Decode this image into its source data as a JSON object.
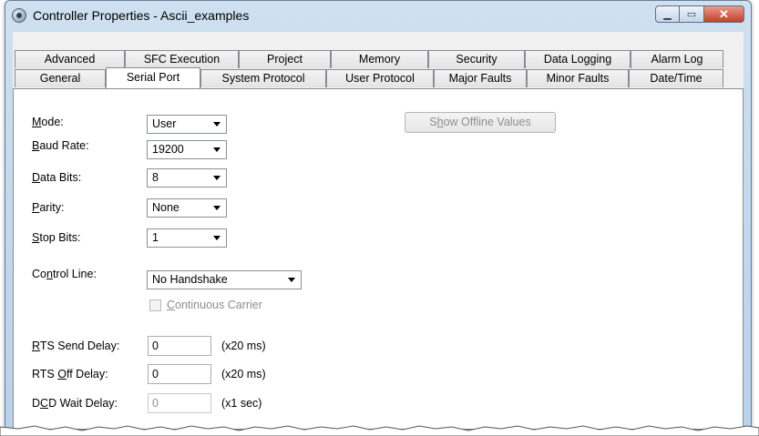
{
  "window": {
    "title": "Controller Properties - Ascii_examples",
    "minimize_glyph": "▁",
    "maximize_glyph": "▭",
    "close_glyph": "✕"
  },
  "tabs": {
    "row1": [
      "Advanced",
      "SFC Execution",
      "Project",
      "Memory",
      "Security",
      "Data Logging",
      "Alarm Log"
    ],
    "row2": [
      "General",
      "Serial Port",
      "System Protocol",
      "User Protocol",
      "Major Faults",
      "Minor Faults",
      "Date/Time"
    ],
    "active": "Serial Port"
  },
  "form": {
    "mode": {
      "label_u": "M",
      "label_rest": "ode:",
      "value": "User"
    },
    "baud_rate": {
      "label_u": "B",
      "label_rest": "aud Rate:",
      "value": "19200"
    },
    "data_bits": {
      "label_u": "D",
      "label_rest": "ata Bits:",
      "value": "8"
    },
    "parity": {
      "label_u": "P",
      "label_rest": "arity:",
      "value": "None"
    },
    "stop_bits": {
      "label_u": "S",
      "label_rest": "top Bits:",
      "value": "1"
    },
    "control_line": {
      "label_pre": "Co",
      "label_u": "n",
      "label_rest": "trol Line:",
      "value": "No Handshake"
    },
    "continuous_carrier": {
      "label_u": "C",
      "label_rest": "ontinuous Carrier",
      "checked": false,
      "enabled": false
    },
    "rts_send_delay": {
      "label_u": "R",
      "label_rest": "TS Send Delay:",
      "value": "0",
      "unit": "(x20 ms)"
    },
    "rts_off_delay": {
      "label_pre": "RTS ",
      "label_u": "O",
      "label_rest": "ff Delay:",
      "value": "0",
      "unit": "(x20 ms)"
    },
    "dcd_wait_delay": {
      "label_pre": "D",
      "label_u": "C",
      "label_rest": "D Wait Delay:",
      "value": "0",
      "unit": "(x1 sec)"
    }
  },
  "show_offline_button": {
    "label_pre": "S",
    "label_u": "h",
    "label_rest": "ow Offline Values",
    "enabled": false
  },
  "icons": {
    "app": "controller-gear-icon",
    "dropdown": "chevron-down-icon"
  }
}
